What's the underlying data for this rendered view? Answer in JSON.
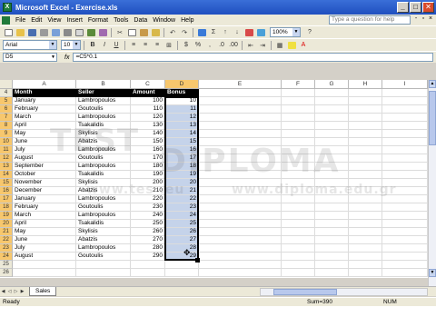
{
  "titlebar": {
    "title": "Microsoft Excel - Exercise.xls",
    "icon": "excel-app-icon",
    "btn_min": "_",
    "btn_max": "□",
    "btn_close": "✕"
  },
  "menubar": {
    "items": [
      "File",
      "Edit",
      "View",
      "Insert",
      "Format",
      "Tools",
      "Data",
      "Window",
      "Help"
    ],
    "help_placeholder": "Type a question for help",
    "doc_min": "-",
    "doc_restore": "▫",
    "doc_close": "×"
  },
  "toolbar": {
    "zoom": "100%",
    "font_name": "Arial",
    "font_size": "10",
    "bold": "B",
    "italic": "I",
    "underline": "U",
    "sigma": "Σ",
    "percent": "%",
    "currency": "$"
  },
  "formula_bar": {
    "name_box": "D5",
    "fx": "fx",
    "formula": "=C5*0.1"
  },
  "columns": [
    "A",
    "B",
    "C",
    "D",
    "E",
    "F",
    "G",
    "H",
    "I"
  ],
  "header_row": {
    "row": 4,
    "values": [
      "Month",
      "Seller",
      "Amount",
      "Bonus"
    ]
  },
  "rows": [
    {
      "n": 5,
      "month": "January",
      "seller": "Lambropoulos",
      "amount": "100",
      "bonus": "10"
    },
    {
      "n": 6,
      "month": "February",
      "seller": "Goutoulis",
      "amount": "110",
      "bonus": "11"
    },
    {
      "n": 7,
      "month": "March",
      "seller": "Lambropoulos",
      "amount": "120",
      "bonus": "12"
    },
    {
      "n": 8,
      "month": "April",
      "seller": "Tsakalidis",
      "amount": "130",
      "bonus": "13"
    },
    {
      "n": 9,
      "month": "May",
      "seller": "Skylisis",
      "amount": "140",
      "bonus": "14"
    },
    {
      "n": 10,
      "month": "June",
      "seller": "Abatzis",
      "amount": "150",
      "bonus": "15"
    },
    {
      "n": 11,
      "month": "July",
      "seller": "Lambropoulos",
      "amount": "160",
      "bonus": "16"
    },
    {
      "n": 12,
      "month": "August",
      "seller": "Goutoulis",
      "amount": "170",
      "bonus": "17"
    },
    {
      "n": 13,
      "month": "September",
      "seller": "Lambropoulos",
      "amount": "180",
      "bonus": "18"
    },
    {
      "n": 14,
      "month": "October",
      "seller": "Tsakalidis",
      "amount": "190",
      "bonus": "19"
    },
    {
      "n": 15,
      "month": "November",
      "seller": "Skylisis",
      "amount": "200",
      "bonus": "20"
    },
    {
      "n": 16,
      "month": "December",
      "seller": "Abatzis",
      "amount": "210",
      "bonus": "21"
    },
    {
      "n": 17,
      "month": "January",
      "seller": "Lambropoulos",
      "amount": "220",
      "bonus": "22"
    },
    {
      "n": 18,
      "month": "February",
      "seller": "Goutoulis",
      "amount": "230",
      "bonus": "23"
    },
    {
      "n": 19,
      "month": "March",
      "seller": "Lambropoulos",
      "amount": "240",
      "bonus": "24"
    },
    {
      "n": 20,
      "month": "April",
      "seller": "Tsakalidis",
      "amount": "250",
      "bonus": "25"
    },
    {
      "n": 21,
      "month": "May",
      "seller": "Skylisis",
      "amount": "260",
      "bonus": "26"
    },
    {
      "n": 22,
      "month": "June",
      "seller": "Abatzis",
      "amount": "270",
      "bonus": "27"
    },
    {
      "n": 23,
      "month": "July",
      "seller": "Lambropoulos",
      "amount": "280",
      "bonus": "28"
    },
    {
      "n": 24,
      "month": "August",
      "seller": "Goutoulis",
      "amount": "290",
      "bonus": "29"
    }
  ],
  "blank_rows": [
    25,
    26
  ],
  "sheet_tabs": [
    "Sales"
  ],
  "status": {
    "left": "Ready",
    "sum": "Sum=390",
    "num": "NUM"
  },
  "watermark": {
    "logo": "TEST",
    "brand": "DIPLOMA",
    "url_left": "www.tes        .eu",
    "url_right": "www.diploma.edu.gr"
  },
  "colors": {
    "accent": "#3a6fd8",
    "selection_fill": "#c5d3ea",
    "header_highlight": "#f7c76d"
  }
}
